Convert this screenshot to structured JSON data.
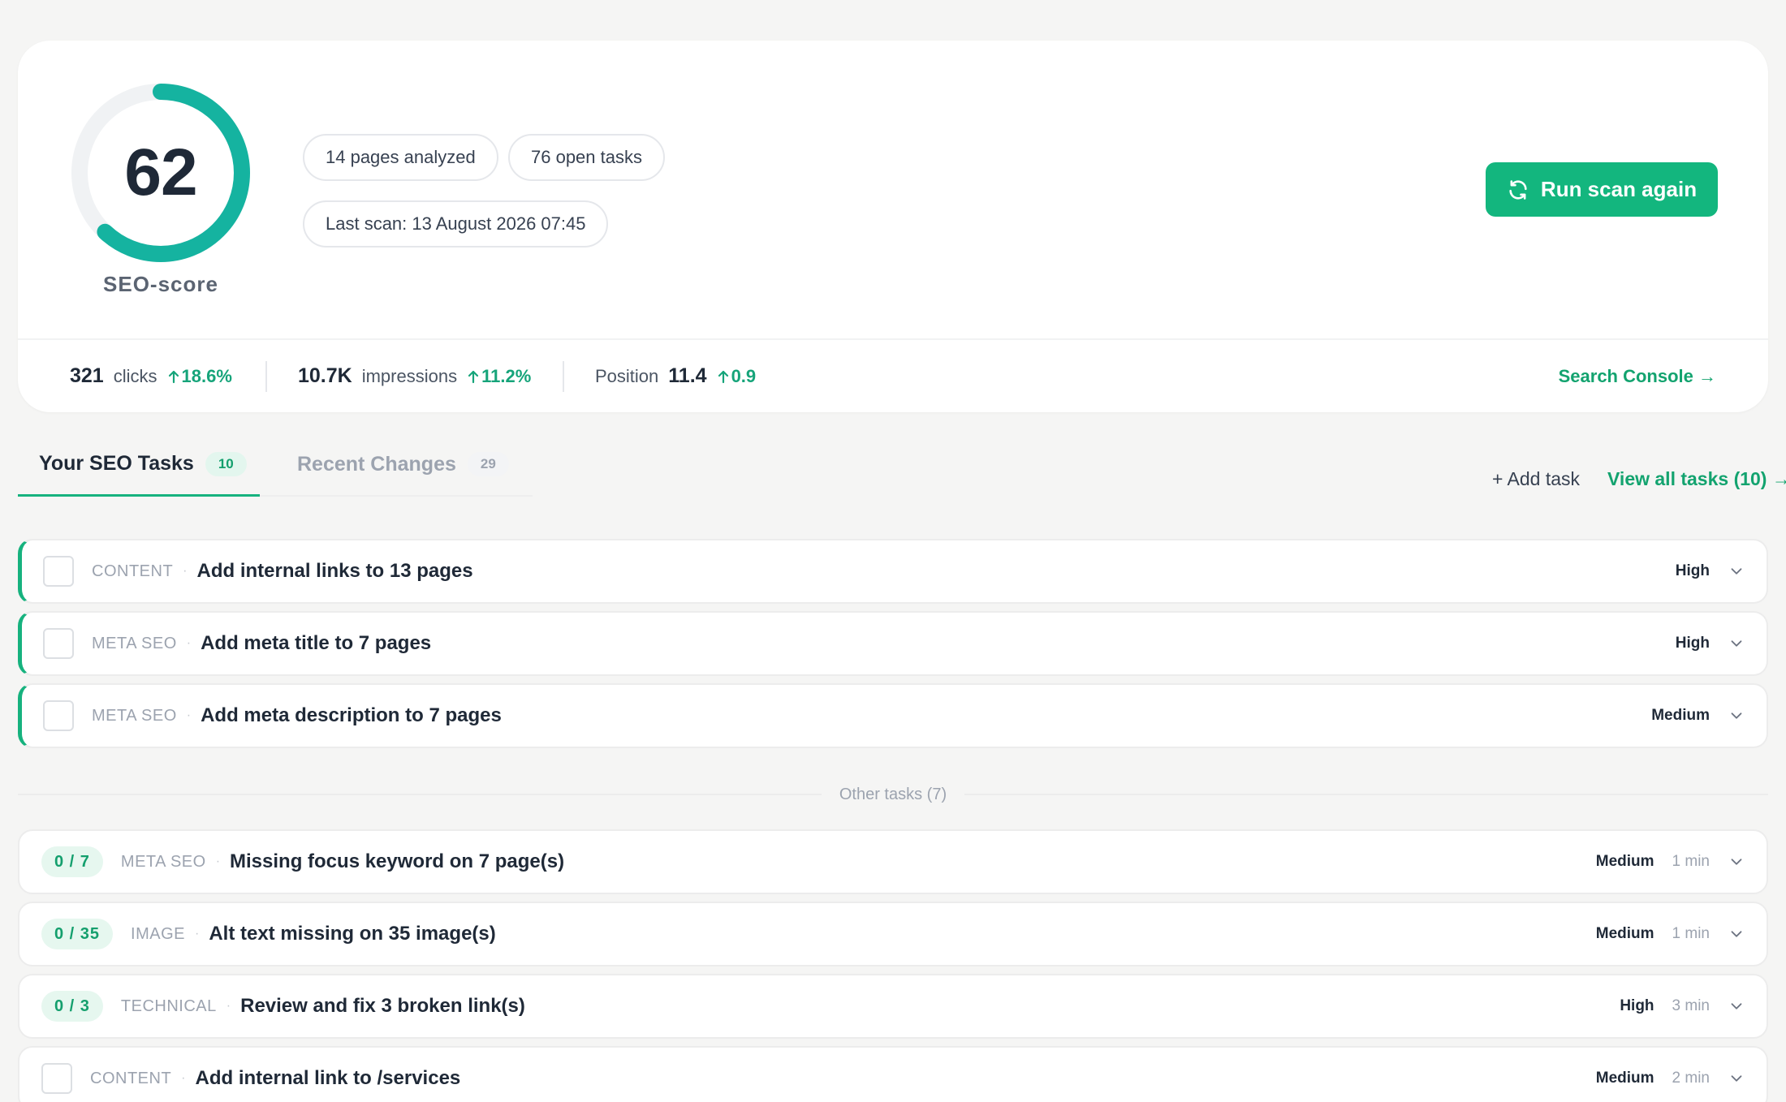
{
  "score": {
    "value": "62",
    "progress": 0.62,
    "label": "SEO-score",
    "color": "#15b3a0"
  },
  "pills": {
    "pages": "14 pages analyzed",
    "tasks": "76 open tasks",
    "last_scan": "Last scan: 13 August 2026 07:45"
  },
  "run_button": {
    "label": "Run scan again",
    "icon": "refresh-icon",
    "color": "#13b67e"
  },
  "stats": {
    "clicks": {
      "value": "321",
      "label": "clicks",
      "delta": "18.6%"
    },
    "impressions": {
      "value": "10.7K",
      "label": "impressions",
      "delta": "11.2%"
    },
    "position": {
      "label": "Position",
      "value": "11.4",
      "delta": "0.9"
    },
    "search_console": "Search Console →"
  },
  "tabs": [
    {
      "label": "Your SEO Tasks",
      "count": "10",
      "active": true
    },
    {
      "label": "Recent Changes",
      "count": "29",
      "active": false
    }
  ],
  "actions": {
    "add_task": "+ Add task",
    "view_all": "View all tasks (10) →"
  },
  "priority_tasks": [
    {
      "category": "CONTENT",
      "title": "Add internal links to 13 pages",
      "priority": "High"
    },
    {
      "category": "META SEO",
      "title": "Add meta title to 7 pages",
      "priority": "High"
    },
    {
      "category": "META SEO",
      "title": "Add meta description to 7 pages",
      "priority": "Medium"
    }
  ],
  "other_label": "Other tasks (7)",
  "other_tasks": [
    {
      "progress": "0 / 7",
      "category": "META SEO",
      "title": "Missing focus keyword on 7 page(s)",
      "priority": "Medium",
      "time": "1 min"
    },
    {
      "progress": "0 / 35",
      "category": "IMAGE",
      "title": "Alt text missing on 35 image(s)",
      "priority": "Medium",
      "time": "1 min"
    },
    {
      "progress": "0 / 3",
      "category": "TECHNICAL",
      "title": "Review and fix 3 broken link(s)",
      "priority": "High",
      "time": "3 min"
    },
    {
      "progress": "",
      "category": "CONTENT",
      "title": "Add internal link to /services",
      "priority": "Medium",
      "time": "2 min"
    }
  ],
  "accent_color": "#16b27e"
}
